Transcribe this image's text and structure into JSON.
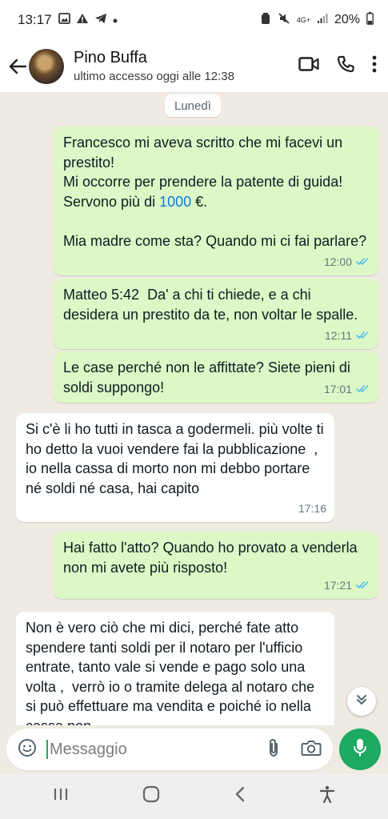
{
  "status_bar": {
    "time": "13:17",
    "network": "4G+",
    "battery": "20%",
    "icons": [
      "gallery-icon",
      "warning-icon",
      "telegram-icon",
      "dot-icon",
      "alarm-icon",
      "mute-icon",
      "signal-icon",
      "battery-icon"
    ]
  },
  "header": {
    "contact_name": "Pino Buffa",
    "contact_status": "ultimo accesso oggi alle 12:38",
    "icons": [
      "back-arrow-icon",
      "video-call-icon",
      "phone-icon",
      "more-vert-icon"
    ]
  },
  "chat": {
    "day_label": "Lunedì",
    "messages": [
      {
        "direction": "out",
        "text_before": "Francesco mi aveva scritto che mi facevi un prestito!\nMi occorre per prendere la patente di guida! Servono più di ",
        "link": "1000",
        "text_after": " €.\n\nMia madre come sta? Quando mi ci fai parlare?",
        "time": "12:00",
        "read": true
      },
      {
        "direction": "out",
        "text": "Matteo 5:42  Da' a chi ti chiede, e a chi desidera un prestito da te, non voltar le spalle.",
        "time": "12:11",
        "read": true
      },
      {
        "direction": "out",
        "text": "Le case perché non le affittate? Siete pieni di soldi suppongo!",
        "time": "17:01",
        "read": true
      },
      {
        "direction": "in",
        "text": "Si c'è li ho tutti in tasca a godermeli. più volte ti ho detto la vuoi vendere fai la pubblicazione  , io nella cassa di morto non mi debbo portare né soldi né casa, hai capito",
        "time": "17:16"
      },
      {
        "direction": "out",
        "text": "Hai fatto l'atto? Quando ho provato a venderla non mi avete più risposto!",
        "time": "17:21",
        "read": true
      },
      {
        "direction": "in",
        "text": "Non è vero ciò che mi dici, perché fate atto spendere tanti soldi per il notaro per l'ufficio entrate, tanto vale si vende e pago solo una volta ,  verrò io o tramite delega al notaro che si può effettuare ma vendita e poiché io nella cassa non"
      }
    ]
  },
  "input_bar": {
    "placeholder": "Messaggio",
    "icons": [
      "emoji-icon",
      "attach-icon",
      "camera-icon",
      "mic-icon"
    ]
  },
  "colors": {
    "outgoing_bubble": "#dbf8c6",
    "incoming_bubble": "#ffffff",
    "chat_background": "#efeae2",
    "read_ticks": "#53bdeb",
    "mic_button": "#1daa61",
    "link": "#1479d3"
  }
}
